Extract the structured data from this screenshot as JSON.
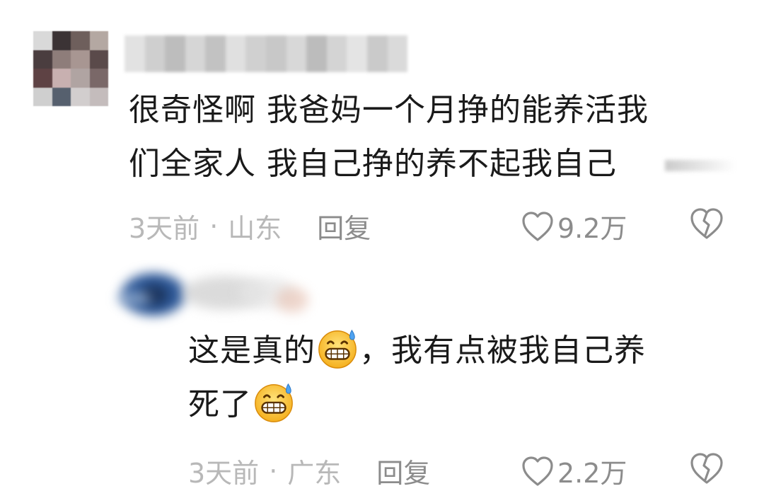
{
  "comments": [
    {
      "text_line1": "很奇怪啊 我爸妈一个月挣的能养活我",
      "text_line2": "们全家人 我自己挣的养不起我自己",
      "time": "3天前",
      "separator": "·",
      "location": "山东",
      "reply_label": "回复",
      "likes": "9.2万"
    },
    {
      "text_part1": "这是真的",
      "text_part2": "，我有点被我自己养",
      "text_part3": "死了",
      "time": "3天前",
      "separator": "·",
      "location": "广东",
      "reply_label": "回复",
      "likes": "2.2万"
    }
  ],
  "icons": {
    "like": "heart-outline-icon",
    "dislike": "broken-heart-icon",
    "emoji": "grinning-sweat-emoji-icon"
  },
  "colors": {
    "text": "#1a1a1a",
    "meta": "#b8b8b8",
    "action": "#8c8c8c"
  }
}
